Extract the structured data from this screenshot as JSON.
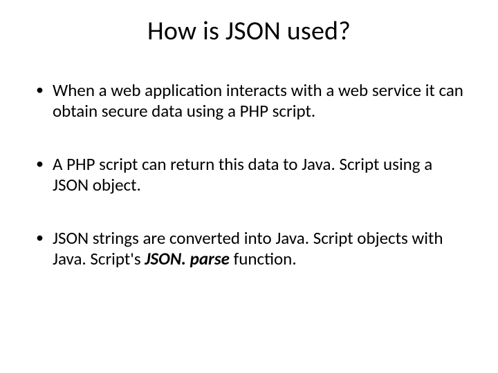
{
  "slide": {
    "title": "How is JSON used?",
    "bullets": [
      "When a web application interacts with a web service it can obtain secure data using a PHP script.",
      "A PHP script can return this data to Java. Script using a JSON object.",
      "JSON strings are converted into Java. Script objects with Java. Script's  JSON. parse  function."
    ],
    "bullet3_prefix": "JSON strings are converted into Java. Script objects with Java. Script's  ",
    "bullet3_bold": "JSON. parse",
    "bullet3_suffix": "  function."
  }
}
